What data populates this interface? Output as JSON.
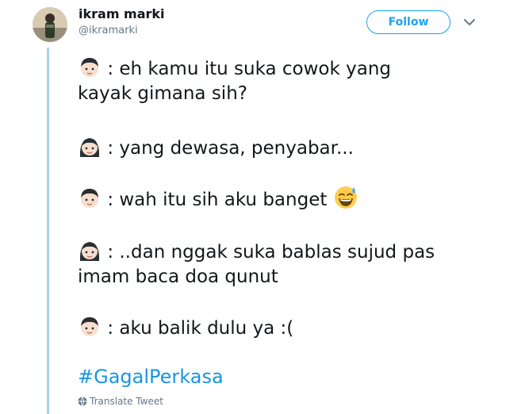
{
  "author": {
    "display_name": "ikram marki",
    "handle": "@ikramarki"
  },
  "header": {
    "follow_label": "Follow",
    "menu_icon": "chevron-down-icon"
  },
  "tweet": {
    "lines": [
      {
        "speaker_icon": "boy-face-icon",
        "text": ":  eh kamu itu suka cowok yang"
      },
      {
        "speaker_icon": null,
        "text": "kayak gimana sih?"
      },
      {
        "speaker_icon": "girl-face-icon",
        "text": ": yang dewasa, penyabar..."
      },
      {
        "speaker_icon": "boy-face-icon",
        "text": ": wah itu sih aku banget",
        "trailing_icon": "grinning-sweat-icon"
      },
      {
        "speaker_icon": "girl-face-icon",
        "text": ": ..dan nggak suka bablas sujud pas"
      },
      {
        "speaker_icon": null,
        "text": "imam baca doa qunut"
      },
      {
        "speaker_icon": "boy-face-icon",
        "text": ": aku balik dulu ya :("
      }
    ],
    "hashtag": "#GagalPerkasa",
    "translate_label": "Translate Tweet"
  },
  "colors": {
    "accent": "#1da1f2",
    "hashtag": "#1b95e0",
    "thread_line": "#a6d4e8",
    "muted": "#657786"
  }
}
